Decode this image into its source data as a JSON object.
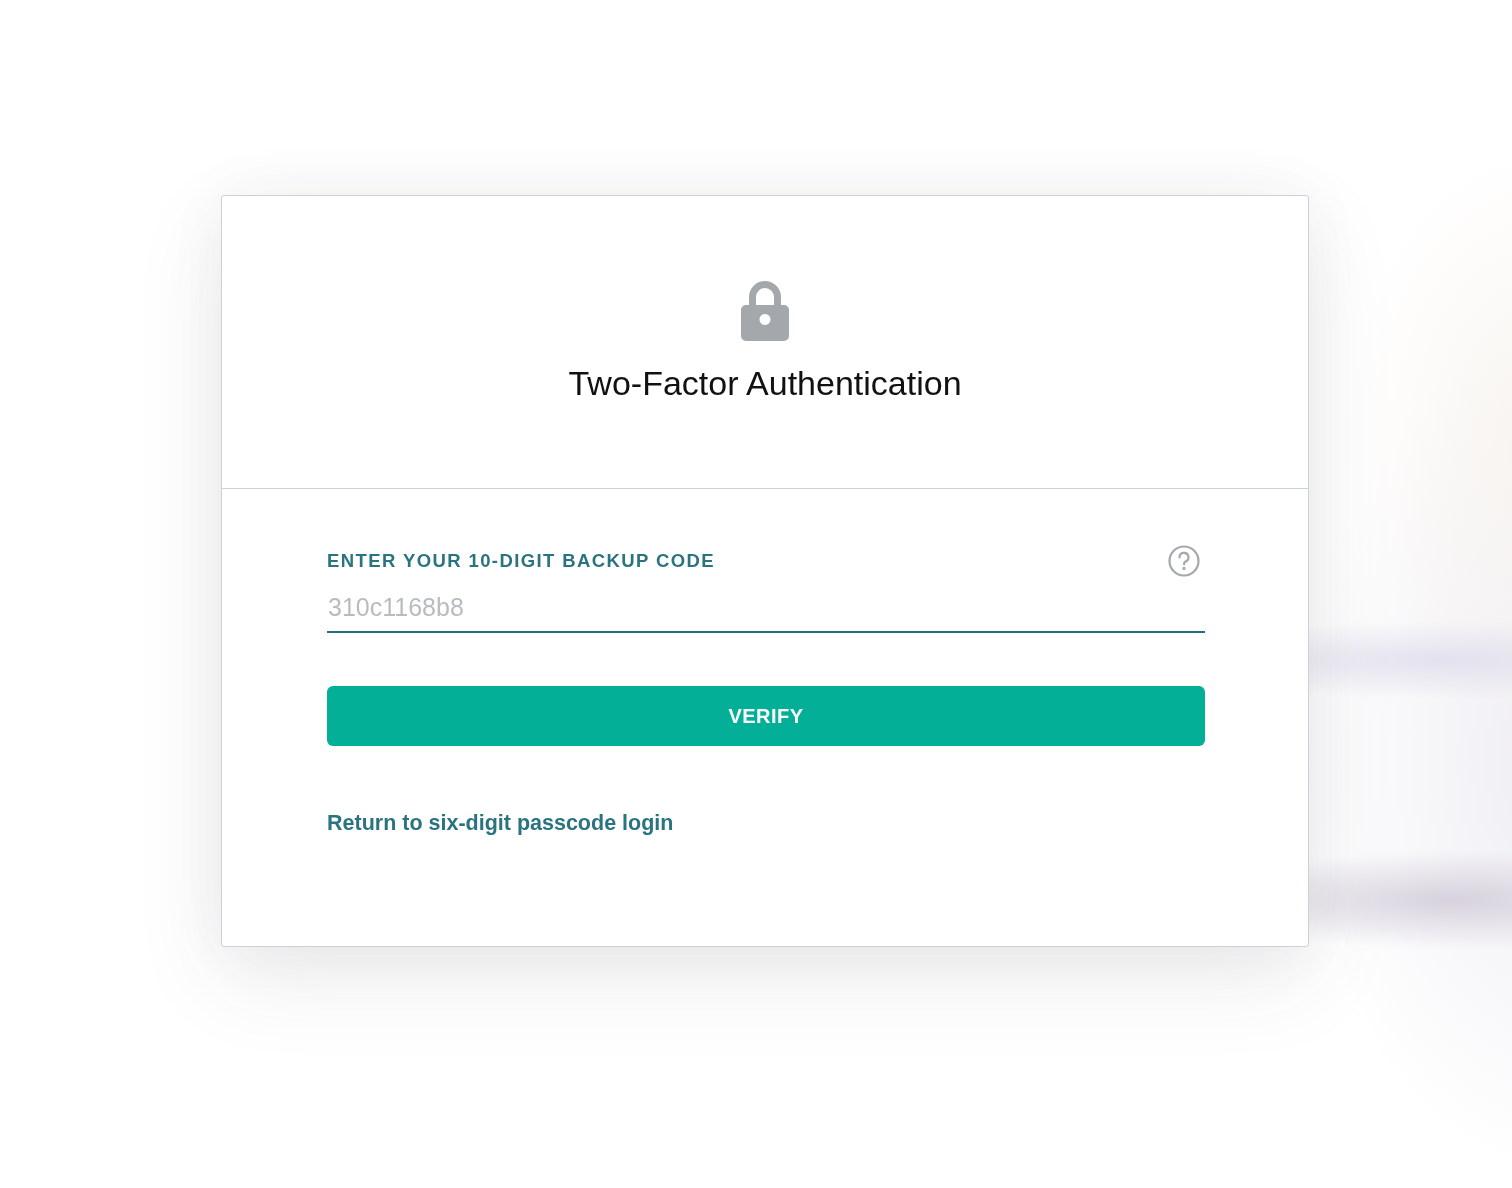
{
  "card": {
    "title": "Two-Factor Authentication"
  },
  "form": {
    "label": "ENTER YOUR 10-DIGIT BACKUP CODE",
    "code_field": {
      "placeholder": "310c1168b8"
    },
    "verify_button": "VERIFY",
    "return_link": "Return to six-digit passcode login"
  }
}
